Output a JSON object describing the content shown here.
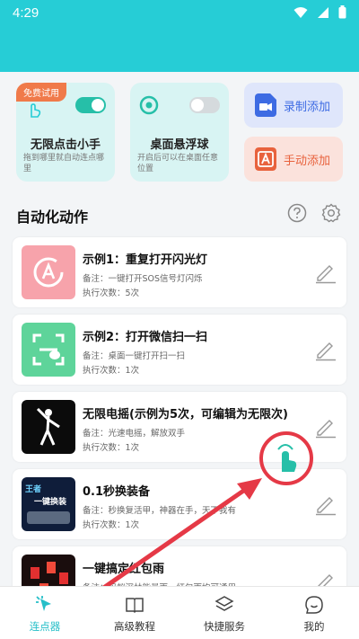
{
  "status": {
    "time": "4:29"
  },
  "cards": {
    "auto_click": {
      "badge": "免费试用",
      "title": "无限点击小手",
      "sub": "拖到哪里就自动连点哪里"
    },
    "float_ball": {
      "title": "桌面悬浮球",
      "sub": "开启后可以在桌面任意位置"
    },
    "record": {
      "label": "录制添加"
    },
    "manual": {
      "label": "手动添加"
    }
  },
  "section": {
    "title": "自动化动作"
  },
  "items": [
    {
      "title": "示例1：重复打开闪光灯",
      "note": "备注：一键打开SOS信号灯闪烁",
      "count": "执行次数：5次"
    },
    {
      "title": "示例2：打开微信扫一扫",
      "note": "备注：桌面一键打开扫一扫",
      "count": "执行次数：1次"
    },
    {
      "title": "无限电摇(示例为5次，可编辑为无限次)",
      "note": "备注：光速电摇，解放双手",
      "count": "执行次数：1次"
    },
    {
      "title": "0.1秒换装备",
      "note": "备注：秒换复活甲，神器在手，天下我有",
      "count": "执行次数：1次"
    },
    {
      "title": "一键搞定红包雨",
      "note": "备注：蚂蚁深林能量雨，红包雨均可通用",
      "count": ""
    }
  ],
  "thumb_text": {
    "game_line1": "王者",
    "game_line2": "一键换装"
  },
  "nav": [
    {
      "label": "连点器",
      "icon": "cursor-click-icon",
      "active": true
    },
    {
      "label": "高级教程",
      "icon": "book-icon",
      "active": false
    },
    {
      "label": "快捷服务",
      "icon": "layers-icon",
      "active": false
    },
    {
      "label": "我的",
      "icon": "profile-icon",
      "active": false
    }
  ],
  "colors": {
    "accent": "#26cdd6",
    "badge": "#f07a4a",
    "annotation": "#e53946"
  }
}
